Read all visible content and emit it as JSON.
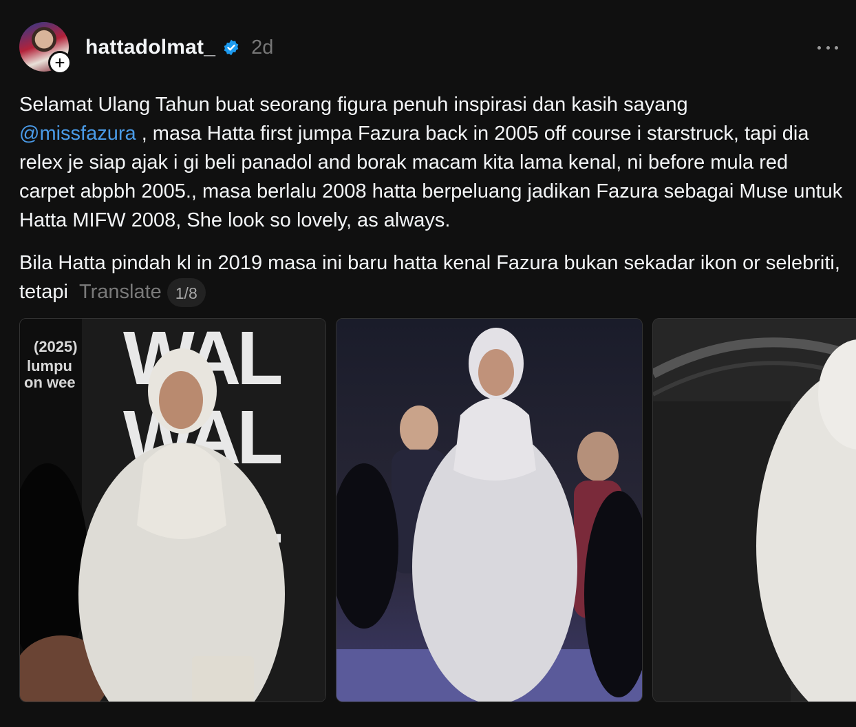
{
  "post": {
    "username": "hattadolmat_",
    "verified_icon": "verified-badge-icon",
    "timestamp": "2d",
    "more_icon": "more-options-icon",
    "follow_icon": "plus-icon",
    "caption": {
      "line1_before": "Selamat Ulang Tahun buat seorang figura penuh inspirasi dan kasih sayang",
      "mention": "@missfazura",
      "line1_after": " , masa Hatta first jumpa Fazura back in 2005 off course i starstruck, tapi dia relex je siap ajak i gi beli panadol and borak macam kita lama kenal, ni before mula red carpet abpbh 2005., masa berlalu 2008 hatta berpeluang jadikan Fazura sebagai Muse untuk Hatta MIFW 2008, She look so lovely, as always.",
      "paragraph2": "Bila Hatta pindah kl in 2019 masa ini baru hatta kenal Fazura bukan sekadar ikon or selebriti, tetapi",
      "translate_label": "Translate",
      "page_counter": "1/8"
    },
    "photos": [
      {
        "overlay_text_1": "(2025)",
        "overlay_text_2": "lumpu",
        "overlay_text_3": "on wee"
      },
      {},
      {}
    ],
    "colors": {
      "background": "#101010",
      "text": "#f3f5f7",
      "mention": "#4a9be8",
      "muted": "#777777",
      "verified": "#1d9bf0"
    }
  }
}
